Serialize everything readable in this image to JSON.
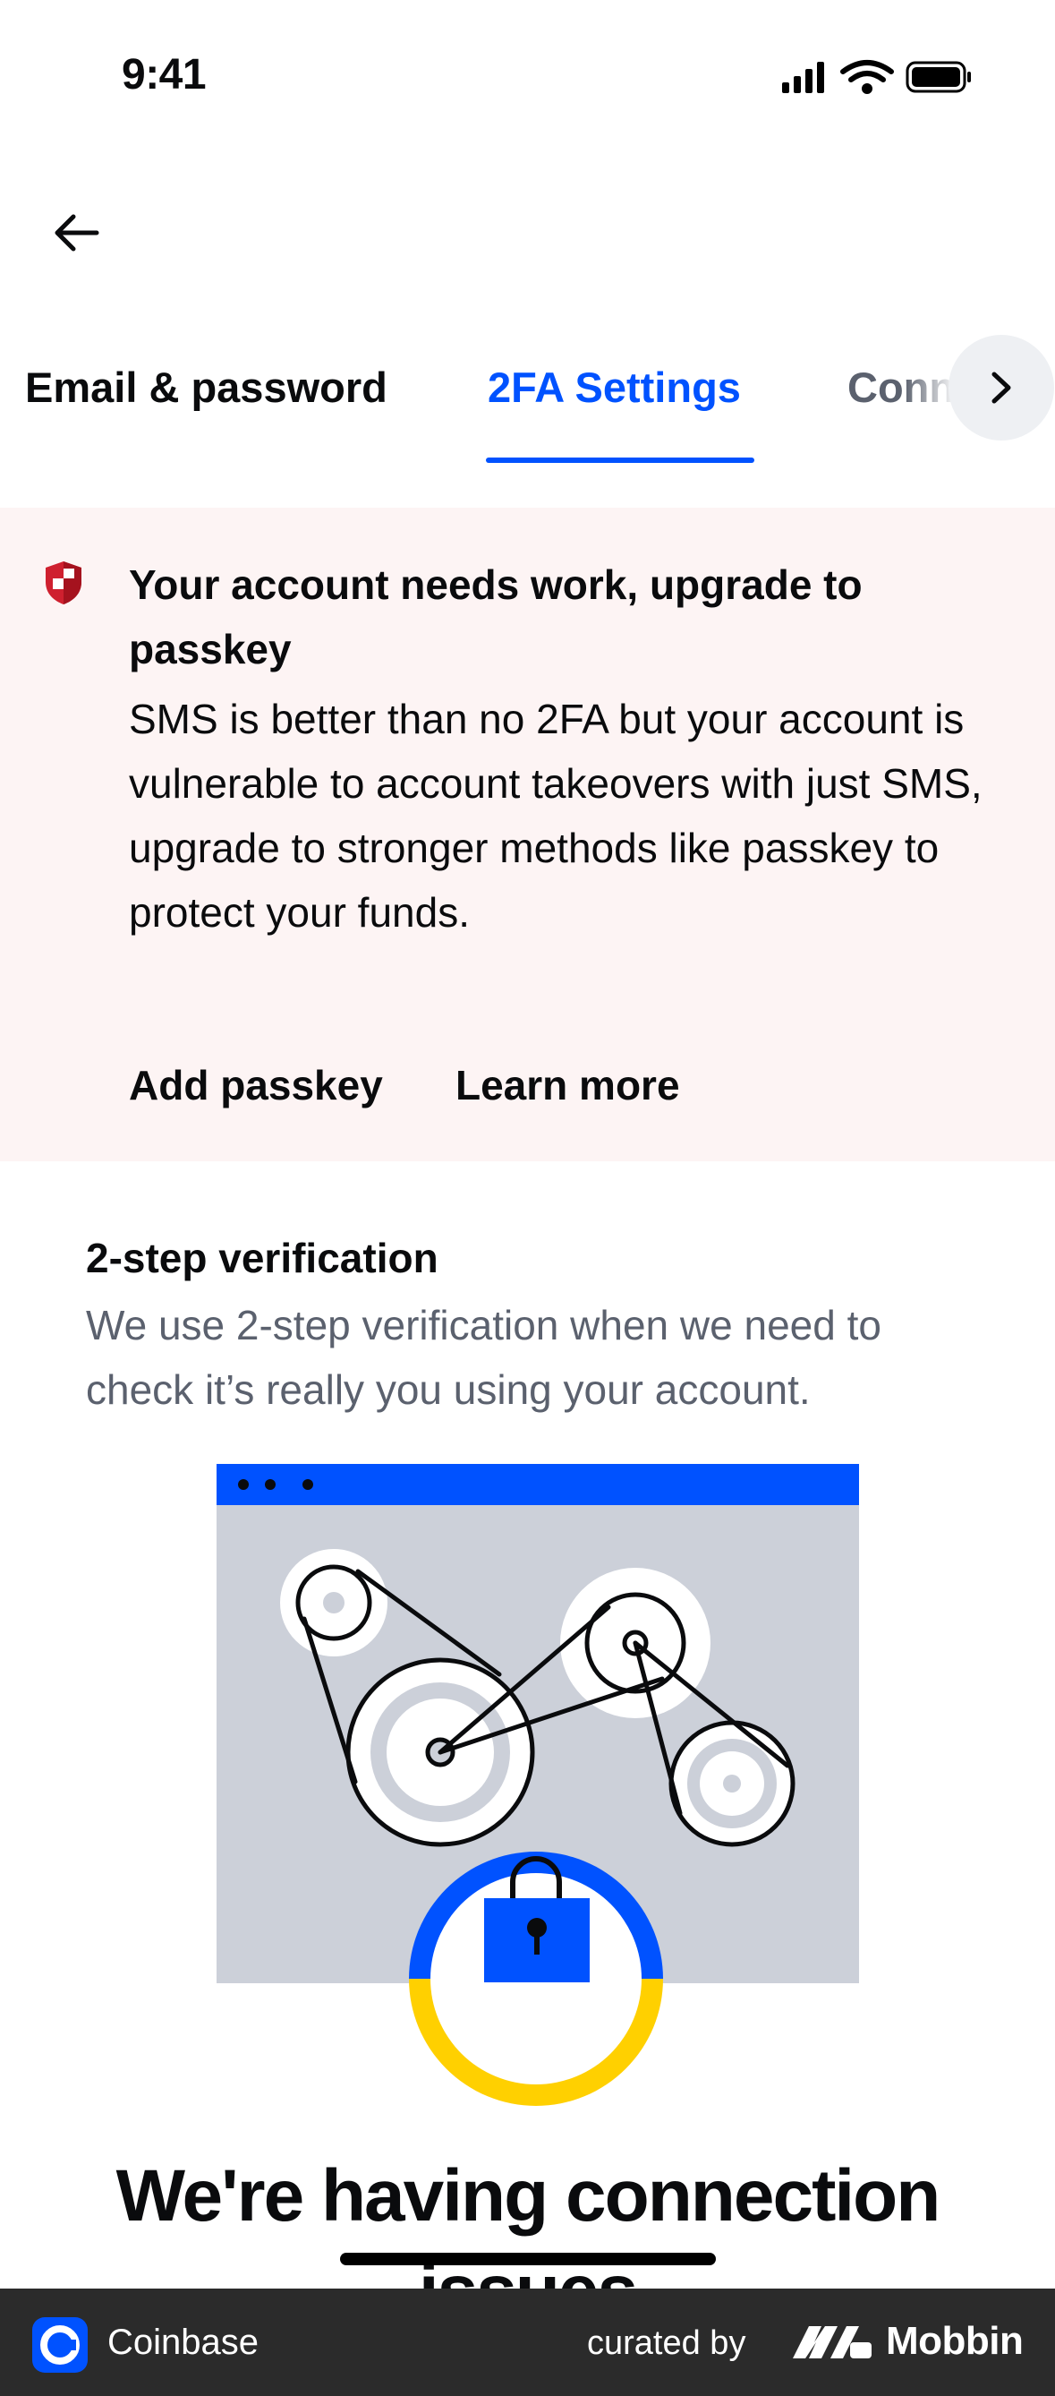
{
  "status_bar": {
    "time": "9:41"
  },
  "tabs": [
    {
      "label": "Email & password"
    },
    {
      "label": "2FA Settings",
      "active": true
    },
    {
      "label": "Conn"
    }
  ],
  "alert": {
    "title": "Your account needs work, upgrade to passkey",
    "body": "SMS is better than no 2FA but your account is vulnerable to account takeovers with just SMS, upgrade to stronger methods like passkey to protect your funds.",
    "actions": {
      "add": "Add passkey",
      "learn": "Learn more"
    },
    "icon": "shield-icon",
    "accent": "#cf202f"
  },
  "two_step": {
    "heading": "2-step verification",
    "description": "We use 2-step verification when we need to check it’s really you using your account."
  },
  "connection_message": "We're having connection issues",
  "footer": {
    "app_name": "Coinbase",
    "curated_by": "curated by",
    "brand": "Mobbin"
  },
  "colors": {
    "brand_blue": "#0052ff",
    "alert_bg": "#fdf4f4",
    "muted_text": "#5b616e",
    "yellow": "#ffd000"
  }
}
